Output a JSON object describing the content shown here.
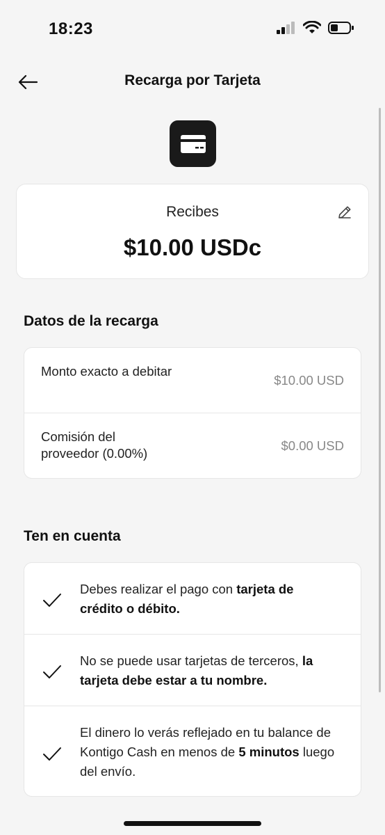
{
  "status": {
    "time": "18:23"
  },
  "header": {
    "title": "Recarga por Tarjeta"
  },
  "receive": {
    "label": "Recibes",
    "amount": "$10.00 USDc"
  },
  "details": {
    "title": "Datos de la recarga",
    "rows": [
      {
        "label": "Monto exacto a debitar",
        "value": "$10.00 USD"
      },
      {
        "label": "Comisión del proveedor (0.00%)",
        "value": "$0.00 USD"
      }
    ]
  },
  "notes": {
    "title": "Ten en cuenta",
    "items": [
      {
        "plain": "Debes realizar el pago con ",
        "bold": "tarjeta de crédito o débito.",
        "after": ""
      },
      {
        "plain": "No se puede usar tarjetas de terceros, ",
        "bold": "la tarjeta debe estar a tu nombre.",
        "after": ""
      },
      {
        "plain": "El dinero lo verás reflejado en tu balance de Kontigo Cash en menos de ",
        "bold": "5 minutos",
        "after": " luego del envío."
      }
    ]
  },
  "icons": {
    "back": "arrow-left-icon",
    "card": "credit-card-icon",
    "edit": "pencil-icon",
    "check": "checkmark-icon"
  }
}
